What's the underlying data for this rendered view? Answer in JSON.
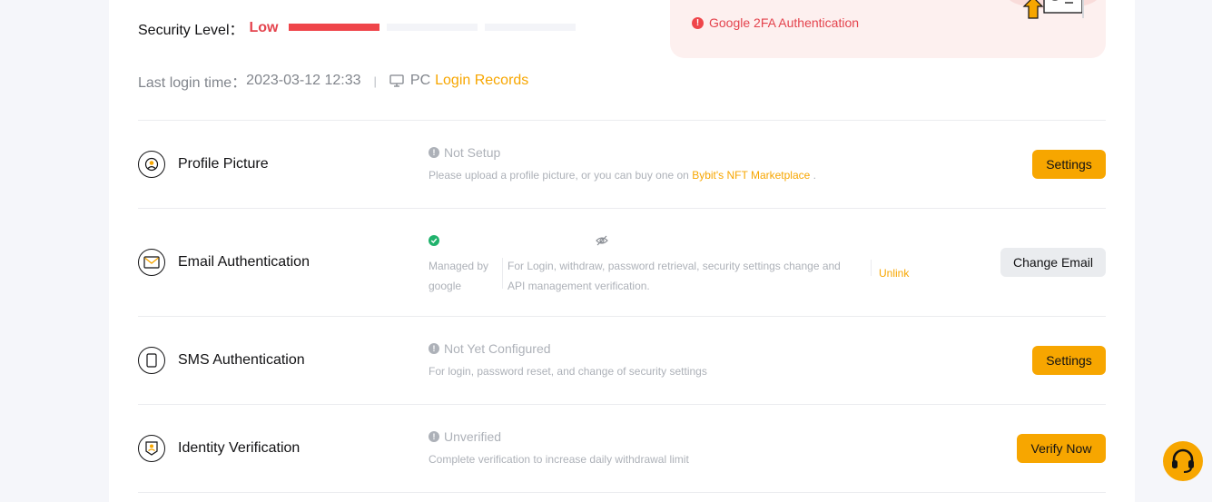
{
  "security": {
    "label": "Security Level：",
    "level": "Low",
    "last_login_label": "Last login time：",
    "last_login_time": "2023-03-12 12:33",
    "separator": "|",
    "device": "PC",
    "login_records_link": "Login Records"
  },
  "promo": {
    "warning_text": "Google 2FA Authentication",
    "warning_icon": "!"
  },
  "rows": {
    "profile": {
      "title": "Profile Picture",
      "status": "Not Setup",
      "desc": "Please upload a profile picture, or you can buy one on",
      "desc_link": "Bybit's NFT Marketplace",
      "desc_end": ".",
      "button": "Settings"
    },
    "email": {
      "title": "Email Authentication",
      "managed_by": "Managed by google",
      "desc": "For Login, withdraw, password retrieval, security settings change and API management verification.",
      "unlink": "Unlink",
      "button": "Change Email"
    },
    "sms": {
      "title": "SMS Authentication",
      "status": "Not Yet Configured",
      "desc": "For login, password reset, and change of security settings",
      "button": "Settings"
    },
    "identity": {
      "title": "Identity Verification",
      "status": "Unverified",
      "desc": "Complete verification to increase daily withdrawal limit",
      "button": "Verify Now"
    }
  },
  "colors": {
    "accent": "#f7a600",
    "danger": "#ef454a",
    "success": "#20b26c",
    "muted": "#adb1b8"
  },
  "icons": {
    "profile": "avatar-icon",
    "email": "envelope-icon",
    "sms": "phone-icon",
    "identity": "id-badge-icon",
    "support": "headset-icon"
  }
}
